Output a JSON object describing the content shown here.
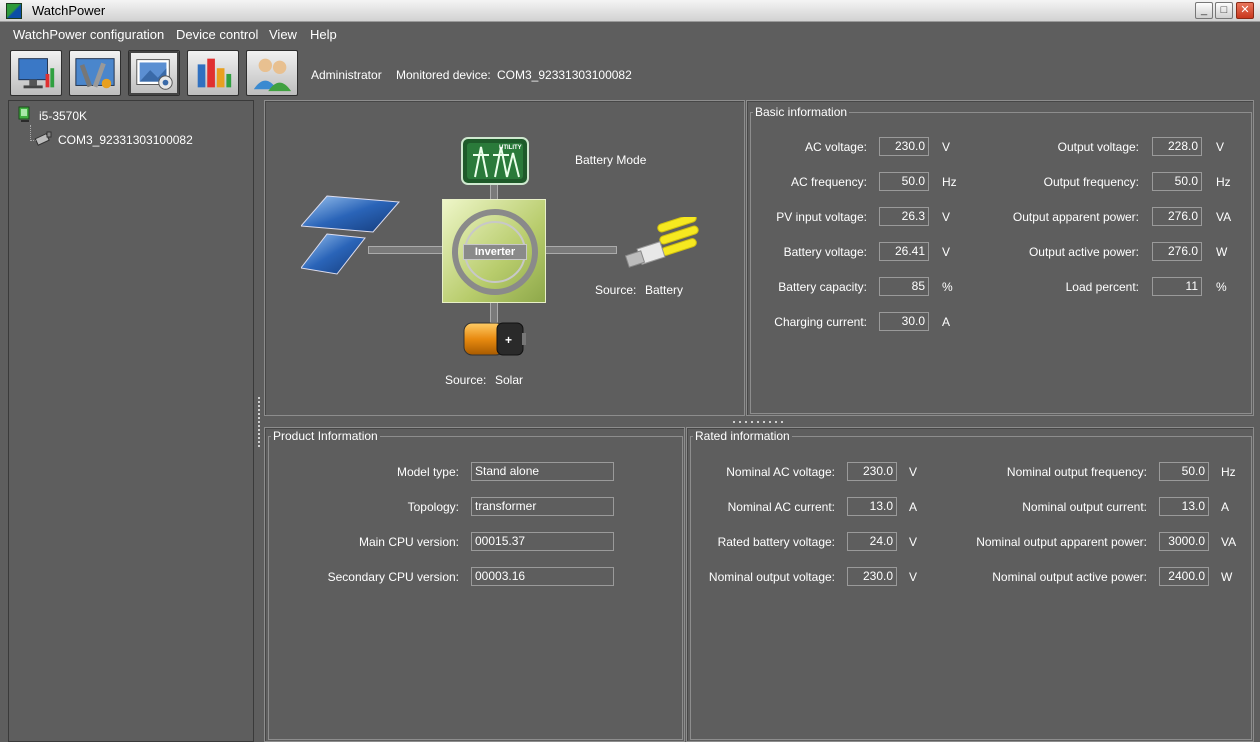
{
  "window": {
    "title": "WatchPower"
  },
  "menu": [
    "WatchPower configuration",
    "Device control",
    "View",
    "Help"
  ],
  "toolbar": {
    "buttons": [
      "monitor-icon",
      "tools-icon",
      "image-icon",
      "chart-icon",
      "users-icon"
    ],
    "user": "Administrator",
    "monitored_label": "Monitored device:",
    "monitored_device": "COM3_92331303100082"
  },
  "tree": {
    "root": "i5-3570K",
    "child": "COM3_92331303100082"
  },
  "diagram": {
    "mode": "Battery Mode",
    "inverter_label": "Inverter",
    "utility_label": "UTILITY",
    "source_battery_label": "Source:",
    "source_battery_value": "Battery",
    "source_solar_label": "Source:",
    "source_solar_value": "Solar"
  },
  "basic_info": {
    "title": "Basic information",
    "left": [
      {
        "label": "AC voltage:",
        "value": "230.0",
        "unit": "V"
      },
      {
        "label": "AC frequency:",
        "value": "50.0",
        "unit": "Hz"
      },
      {
        "label": "PV input voltage:",
        "value": "26.3",
        "unit": "V"
      },
      {
        "label": "Battery voltage:",
        "value": "26.41",
        "unit": "V"
      },
      {
        "label": "Battery capacity:",
        "value": "85",
        "unit": "%"
      },
      {
        "label": "Charging current:",
        "value": "30.0",
        "unit": "A"
      }
    ],
    "right": [
      {
        "label": "Output voltage:",
        "value": "228.0",
        "unit": "V"
      },
      {
        "label": "Output frequency:",
        "value": "50.0",
        "unit": "Hz"
      },
      {
        "label": "Output apparent power:",
        "value": "276.0",
        "unit": "VA"
      },
      {
        "label": "Output active power:",
        "value": "276.0",
        "unit": "W"
      },
      {
        "label": "Load percent:",
        "value": "11",
        "unit": "%"
      }
    ]
  },
  "product_info": {
    "title": "Product Information",
    "rows": [
      {
        "label": "Model type:",
        "value": "Stand alone"
      },
      {
        "label": "Topology:",
        "value": "transformer"
      },
      {
        "label": "Main CPU version:",
        "value": "00015.37"
      },
      {
        "label": "Secondary CPU version:",
        "value": "00003.16"
      }
    ]
  },
  "rated_info": {
    "title": "Rated information",
    "left": [
      {
        "label": "Nominal AC voltage:",
        "value": "230.0",
        "unit": "V"
      },
      {
        "label": "Nominal AC current:",
        "value": "13.0",
        "unit": "A"
      },
      {
        "label": "Rated battery voltage:",
        "value": "24.0",
        "unit": "V"
      },
      {
        "label": "Nominal output voltage:",
        "value": "230.0",
        "unit": "V"
      }
    ],
    "right": [
      {
        "label": "Nominal output frequency:",
        "value": "50.0",
        "unit": "Hz"
      },
      {
        "label": "Nominal output current:",
        "value": "13.0",
        "unit": "A"
      },
      {
        "label": "Nominal output apparent power:",
        "value": "3000.0",
        "unit": "VA"
      },
      {
        "label": "Nominal output active power:",
        "value": "2400.0",
        "unit": "W"
      }
    ]
  }
}
